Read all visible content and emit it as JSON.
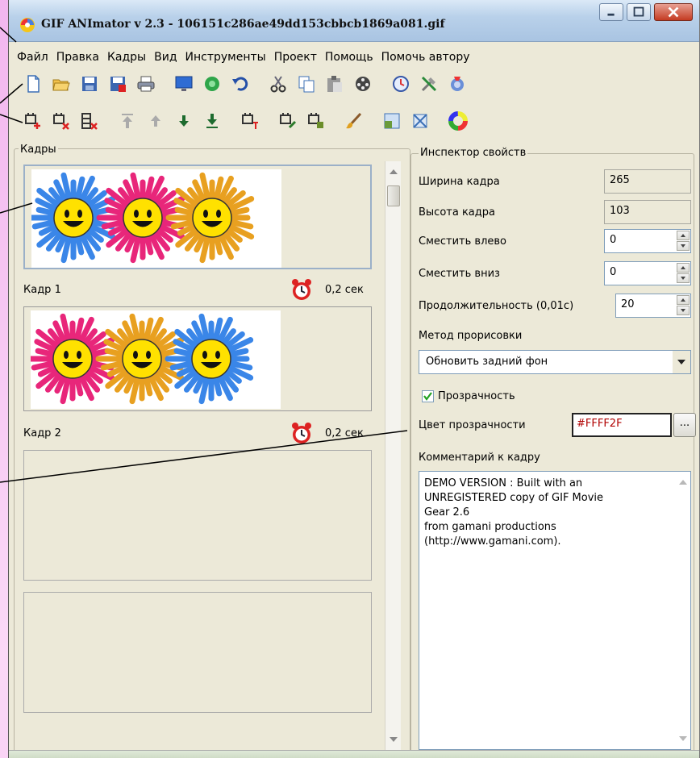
{
  "window": {
    "title": "GIF ANImator v 2.3 - 106151c286ae49dd153cbbcb1869a081.gif"
  },
  "menu": [
    "Файл",
    "Правка",
    "Кадры",
    "Вид",
    "Инструменты",
    "Проект",
    "Помощь",
    "Помочь автору"
  ],
  "toolbar1_icons": [
    "new-file-icon",
    "open-folder-icon",
    "save-icon",
    "save-as-icon",
    "print-icon",
    "preview-monitor-icon",
    "optimize-icon",
    "undo-icon",
    "cut-icon",
    "copy-icon",
    "paste-icon",
    "film-reel-icon",
    "timer-icon",
    "tools-icon",
    "effects-icon"
  ],
  "toolbar2_icons": [
    "add-frame-icon",
    "delete-frame-icon",
    "delete-frames-icon",
    "move-top-icon",
    "move-up-icon",
    "move-down-icon",
    "move-bottom-icon",
    "insert-frame-icon",
    "edit-frame-icon",
    "crop-frame-icon",
    "brush-icon",
    "resize-icon",
    "fit-icon",
    "color-wheel-icon"
  ],
  "frames": {
    "label": "Кадры",
    "items": [
      {
        "name": "Кадр 1",
        "duration": "0,2 сек"
      },
      {
        "name": "Кадр 2",
        "duration": "0,2 сек"
      }
    ],
    "flower_colors_frame1": [
      "#3a86e8",
      "#e8267a",
      "#e8a020"
    ],
    "flower_colors_frame2": [
      "#e8267a",
      "#e8a020",
      "#3a86e8"
    ]
  },
  "inspector": {
    "label": "Инспектор свойств",
    "width_label": "Ширина кадра",
    "width_value": "265",
    "height_label": "Высота кадра",
    "height_value": "103",
    "offset_left_label": "Сместить влево",
    "offset_left_value": "0",
    "offset_down_label": "Сместить вниз",
    "offset_down_value": "0",
    "duration_label": "Продолжительность (0,01с)",
    "duration_value": "20",
    "draw_method_label": "Метод прорисовки",
    "draw_method_value": "Обновить задний фон",
    "transparency_label": "Прозрачность",
    "transparency_checked": true,
    "transparent_color_label": "Цвет прозрачности",
    "transparent_color_value": "#FFFF2F",
    "dots_label": "...",
    "comment_label": "Комментарий к кадру",
    "comment_lines": [
      "DEMO VERSION : Built with an",
      "UNREGISTERED copy of GIF Movie",
      "Gear 2.6",
      "from gamani productions",
      "(http://www.gamani.com)."
    ]
  }
}
